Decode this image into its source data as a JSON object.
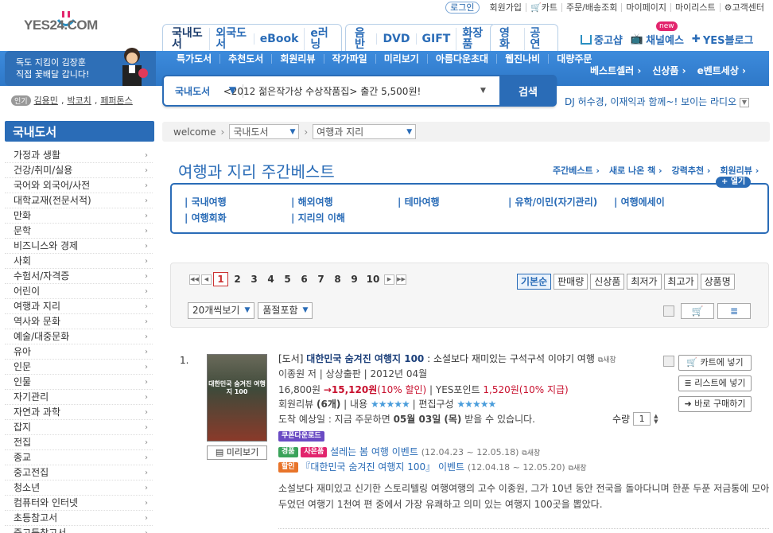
{
  "util": {
    "login": "로그인",
    "links": [
      "회원가입",
      "카트",
      "주문/배송조회",
      "마이페이지",
      "마이리스트",
      "고객센터"
    ]
  },
  "logo": "YES24.COM",
  "tabs1": [
    "국내도서",
    "외국도서",
    "eBook",
    "e러닝"
  ],
  "tabs2": [
    "음반",
    "DVD",
    "GIFT",
    "화장품"
  ],
  "tabs3": [
    "영화",
    "공연"
  ],
  "rightlinks": [
    "중고샵",
    "채널예스",
    "YES블로그"
  ],
  "newbadge": "new",
  "promo": {
    "line1": "독도 지킴이 김장훈",
    "line2": "직접 꽃배달 갑니다!"
  },
  "subnav": [
    "특가도서",
    "추천도서",
    "회원리뷰",
    "작가파일",
    "미리보기",
    "아름다운초대",
    "웹진나비",
    "대량주문"
  ],
  "bandright": [
    "베스트셀러 ›",
    "신상품 ›",
    "e벤트세상 ›"
  ],
  "search": {
    "category": "국내도서",
    "query": "<2012 젊은작가상 수상작품집> 출간 5,500원!",
    "button": "검색"
  },
  "popular": {
    "tag": "인기",
    "keywords": [
      "김용민",
      "박코치",
      "페퍼톤스"
    ]
  },
  "dj": "DJ 허수경, 이재익과 함께~! 보이는 라디오",
  "sidebar": {
    "title": "국내도서",
    "items": [
      "가정과 생활",
      "건강/취미/실용",
      "국어와 외국어/사전",
      "대학교재(전문서적)",
      "만화",
      "문학",
      "비즈니스와 경제",
      "사회",
      "수험서/자격증",
      "어린이",
      "여행과 지리",
      "역사와 문화",
      "예술/대중문화",
      "유아",
      "인문",
      "인물",
      "자기관리",
      "자연과 과학",
      "잡지",
      "전집",
      "종교",
      "중고전집",
      "청소년",
      "컴퓨터와 인터넷",
      "초등참고서",
      "중고등참고서"
    ]
  },
  "crumb": {
    "home": "welcome",
    "sel1": "국내도서",
    "sel2": "여행과 지리"
  },
  "page_title": "여행과 지리 주간베스트",
  "title_links": [
    "주간베스트 ›",
    "새로 나온 책 ›",
    "강력추천 ›",
    "회원리뷰 ›"
  ],
  "more": "+ 열기",
  "categories": [
    "국내여행",
    "해외여행",
    "테마여행",
    "유학/이민(자기관리)",
    "여행에세이",
    "여행회화",
    "지리의 이해"
  ],
  "pages": [
    "1",
    "2",
    "3",
    "4",
    "5",
    "6",
    "7",
    "8",
    "9",
    "10"
  ],
  "sort": [
    "기본순",
    "판매량",
    "신상품",
    "최저가",
    "최고가",
    "상품명"
  ],
  "view": {
    "count": "20개씩보기",
    "filter": "품절포함"
  },
  "item": {
    "num": "1.",
    "prefix": "[도서]",
    "title": "대한민국 숨겨진 여행지 100",
    "subtitle": " : 소설보다 재미있는 구석구석 이야기 여행",
    "newwin": "새창",
    "meta": "이종원 저 | 상상출판 | 2012년 04월",
    "price": "16,800원",
    "sale": "15,120원",
    "discount": "(10% 할인)",
    "points_label": "YES포인트",
    "points": "1,520원",
    "points_rate": "(10% 지급)",
    "review_label": "회원리뷰",
    "review_count": "(6개)",
    "content_label": "내용",
    "layout_label": "편집구성",
    "stars": "★★★★★",
    "delivery_prefix": "도착 예상일 : 지금 주문하면",
    "delivery_date": "05월 03일 (목)",
    "delivery_suffix": "받을 수 있습니다.",
    "coupon": "쿠폰다운로드",
    "ev1_badge1": "경품",
    "ev1_badge2": "사은품",
    "ev1_title": "설레는 봄 여행 이벤트",
    "ev1_date": "(12.04.23 ~ 12.05.18)",
    "ev2_badge": "할인",
    "ev2_title": "『대한민국 숨겨진 여행지 100』 이벤트",
    "ev2_date": "(12.04.18 ~ 12.05.20)",
    "cover_text": "대한민국 숨겨진 여행지 100",
    "preview": "미리보기",
    "qty_label": "수량",
    "qty": "1",
    "btn_cart": "카트에 넣기",
    "btn_list": "리스트에 넣기",
    "btn_buy": "바로 구매하기",
    "desc": "소설보다 재미있고 신기한 스토리텔링 여행여행의 고수 이종원, 그가 10년 동안 전국을 돌아다니며 한푼 두푼 저금통에 모아두었던 여행기 1천여 편 중에서 가장 유쾌하고 의미 있는 여행지 100곳을 뽑았다."
  },
  "colors": {
    "brand": "#2a6cb7",
    "price_red": "#c8102e",
    "band": "#3d8bdc"
  }
}
